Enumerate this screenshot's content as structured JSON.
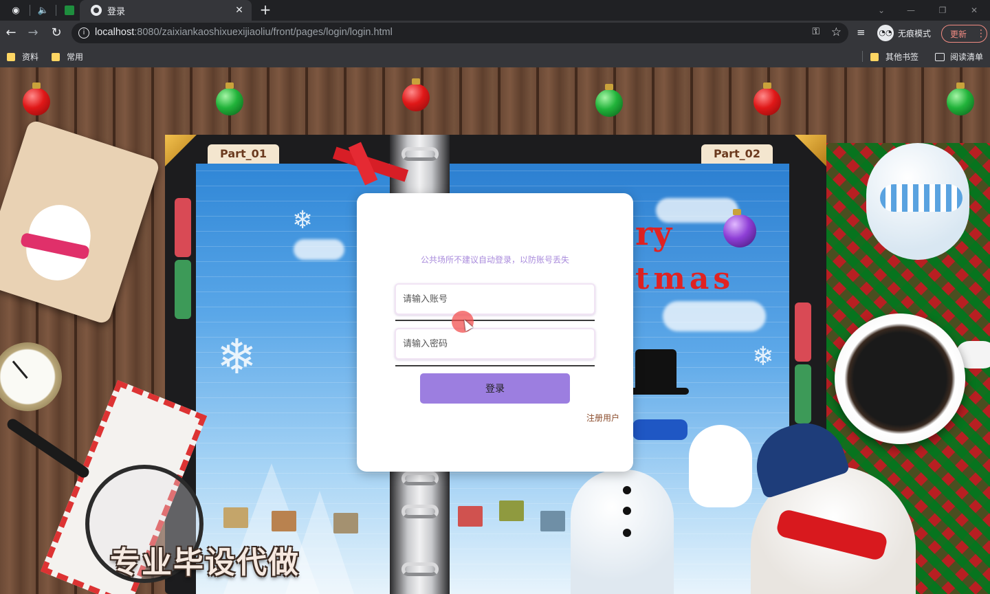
{
  "browser": {
    "tab_title": "登录",
    "tab_close": "✕",
    "new_tab": "+",
    "url_host": "localhost",
    "url_rest": ":8080/zaixiankaoshixuexijiaoliu/front/pages/login/login.html",
    "incognito_label": "无痕模式",
    "update_label": "更新",
    "bookmarks": [
      "资料",
      "常用"
    ],
    "other_bookmarks": "其他书签",
    "reading_list": "阅读清单"
  },
  "book": {
    "part_left": "Part_01",
    "part_right": "Part_02",
    "merry_line1": "ry",
    "merry_line2": "tmas"
  },
  "login": {
    "tip": "公共场所不建议自动登录，以防账号丢失",
    "account_placeholder": "请输入账号",
    "password_placeholder": "请输入密码",
    "login_button": "登录",
    "register_link": "注册用户"
  },
  "watermark": "专业毕设代做",
  "colors": {
    "accent_button": "#9c7ee0",
    "tip_text": "#a98bdc",
    "register_link": "#8a4a2a",
    "update_border": "#f28b82"
  }
}
